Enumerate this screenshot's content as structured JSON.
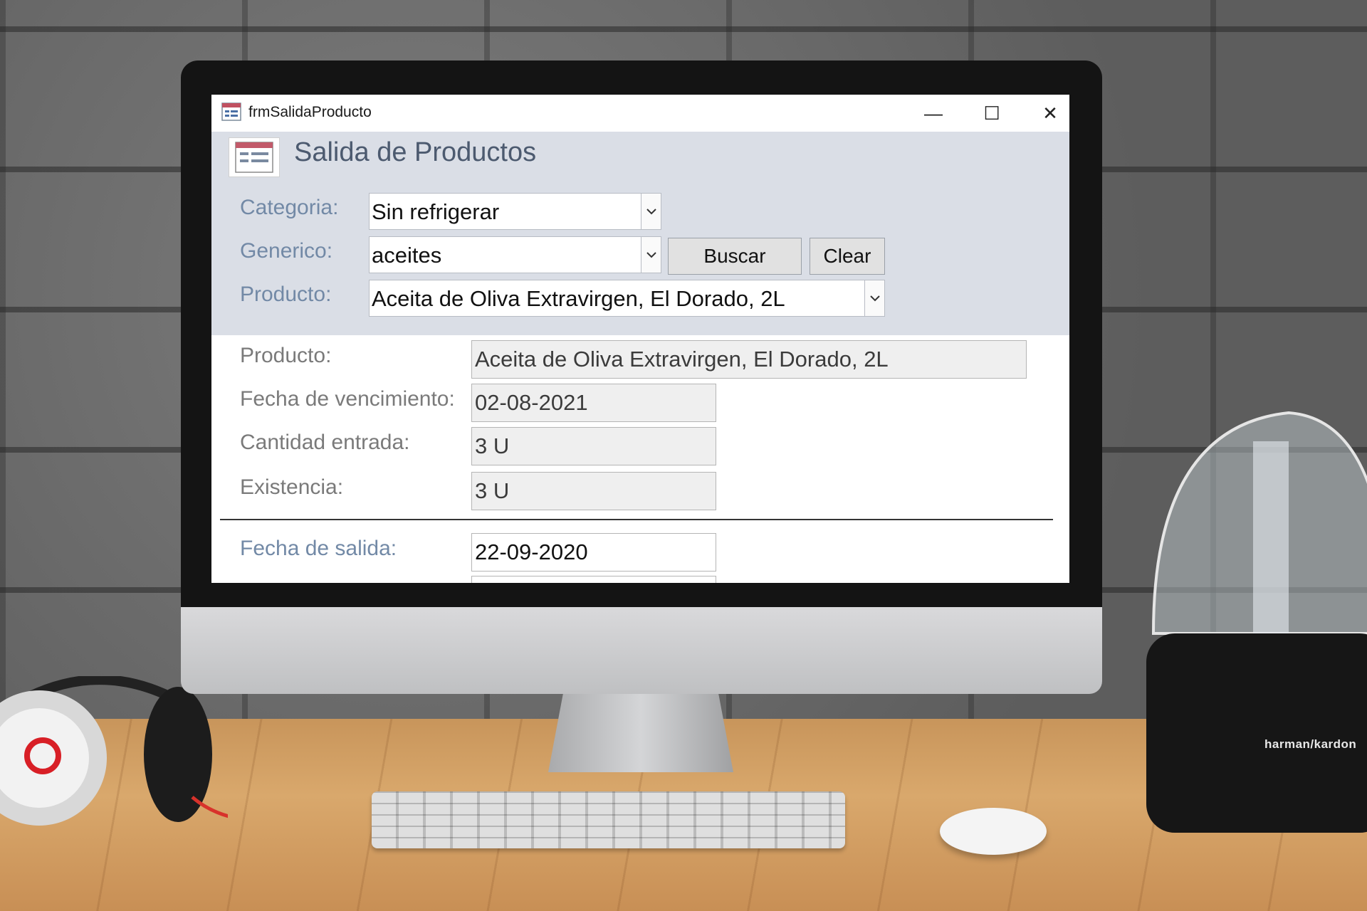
{
  "window": {
    "title": "frmSalidaProducto",
    "minimize_symbol": "—",
    "maximize_symbol": "☐",
    "close_symbol": "✕"
  },
  "form": {
    "title": "Salida de Productos",
    "icon": "form-icon"
  },
  "filters": {
    "categoria_label": "Categoria:",
    "categoria_value": "Sin refrigerar",
    "generico_label": "Generico:",
    "generico_value": "aceites",
    "producto_label": "Producto:",
    "producto_value": "Aceita de Oliva Extravirgen, El Dorado, 2L",
    "buscar_label": "Buscar",
    "clear_label": "Clear"
  },
  "details": {
    "producto_label": "Producto:",
    "producto_value": "Aceita de Oliva Extravirgen, El Dorado, 2L",
    "vencimiento_label": "Fecha de vencimiento:",
    "vencimiento_value": "02-08-2021",
    "cantidad_label": "Cantidad entrada:",
    "cantidad_value": "3 U",
    "existencia_label": "Existencia:",
    "existencia_value": "3 U",
    "salida_label": "Fecha de salida:",
    "salida_value": "22-09-2020"
  },
  "scene": {
    "speaker_brand": "harman/kardon",
    "apple_logo": ""
  },
  "colors": {
    "header_band": "#dadee6",
    "label_blue": "#7289a6",
    "readonly_field": "#efefef"
  }
}
